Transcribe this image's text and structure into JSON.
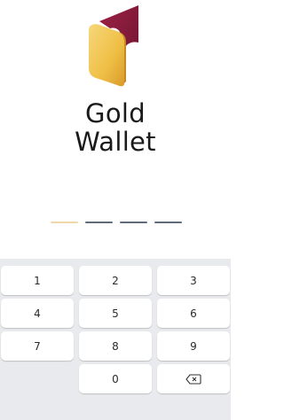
{
  "app": {
    "title_line1": "Gold",
    "title_line2": "Wallet"
  },
  "pin": {
    "length": 4,
    "entered": 1
  },
  "keypad": {
    "rows": [
      [
        "1",
        "2",
        "3"
      ],
      [
        "4",
        "5",
        "6"
      ],
      [
        "7",
        "8",
        "9"
      ],
      [
        "",
        "0",
        "backspace"
      ]
    ],
    "backspace_icon": "backspace-icon"
  },
  "colors": {
    "logo_gold": "#f0c850",
    "logo_burgundy": "#8c1d3c",
    "dash_active": "#f0d9a8",
    "dash_inactive": "#5f6a7a",
    "keypad_bg": "#e9eaed"
  }
}
